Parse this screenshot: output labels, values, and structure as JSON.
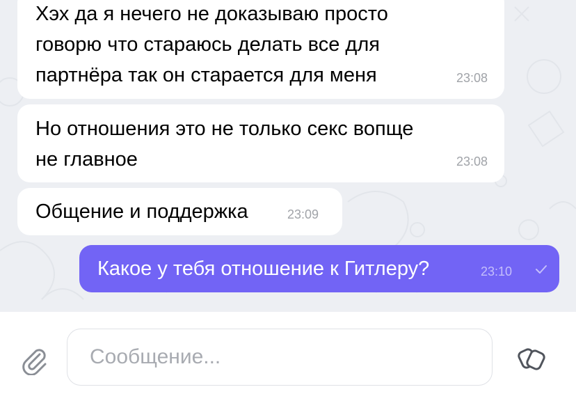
{
  "theme": {
    "chat_background": "#edeff3",
    "incoming_bubble": "#ffffff",
    "outgoing_bubble": "#7264f5",
    "timestamp_color": "#a0a3a8"
  },
  "messages": [
    {
      "direction": "incoming",
      "text": "Хэх да я нечего не доказываю просто\nговорю что стараюсь делать все для\nпартнёра так он старается для меня",
      "time": "23:08"
    },
    {
      "direction": "incoming",
      "text": "Но отношения это не только секс вопще\nне главное",
      "time": "23:08"
    },
    {
      "direction": "incoming",
      "text": "Общение и поддержка",
      "time": "23:09"
    },
    {
      "direction": "outgoing",
      "text": "Какое у тебя отношение к Гитлеру?",
      "time": "23:10",
      "status_icon": "single-check-icon"
    }
  ],
  "composer": {
    "placeholder": "Сообщение...",
    "value": "",
    "attach_icon": "paperclip-icon",
    "sticker_icon": "sticker-icon"
  }
}
